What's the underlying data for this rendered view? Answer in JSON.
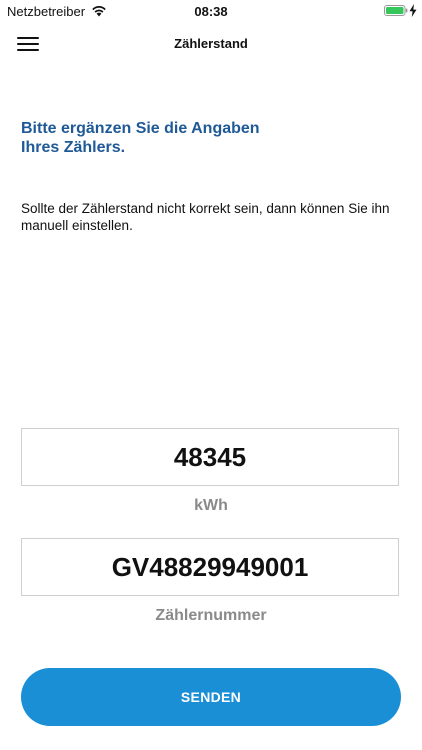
{
  "status_bar": {
    "carrier": "Netzbetreiber",
    "time": "08:38",
    "wifi_icon": "wifi-icon",
    "battery_icon": "battery-icon",
    "charging_icon": "bolt-icon"
  },
  "nav": {
    "title": "Zählerstand",
    "menu_icon": "hamburger-menu-icon"
  },
  "content": {
    "heading_line1": "Bitte ergänzen Sie die Angaben",
    "heading_line2": "Ihres Zählers.",
    "description": "Sollte der Zählerstand nicht korrekt sein, dann können Sie ihn manuell einstellen."
  },
  "meter_reading": {
    "value": "48345",
    "unit": "kWh"
  },
  "meter_number": {
    "value": "GV48829949001",
    "label": "Zählernummer"
  },
  "actions": {
    "send_label": "SENDEN"
  },
  "colors": {
    "heading": "#1f5a96",
    "button": "#1b8fd6",
    "label_gray": "#8a8a8a",
    "border": "#cfcfcf",
    "battery": "#35c759"
  }
}
